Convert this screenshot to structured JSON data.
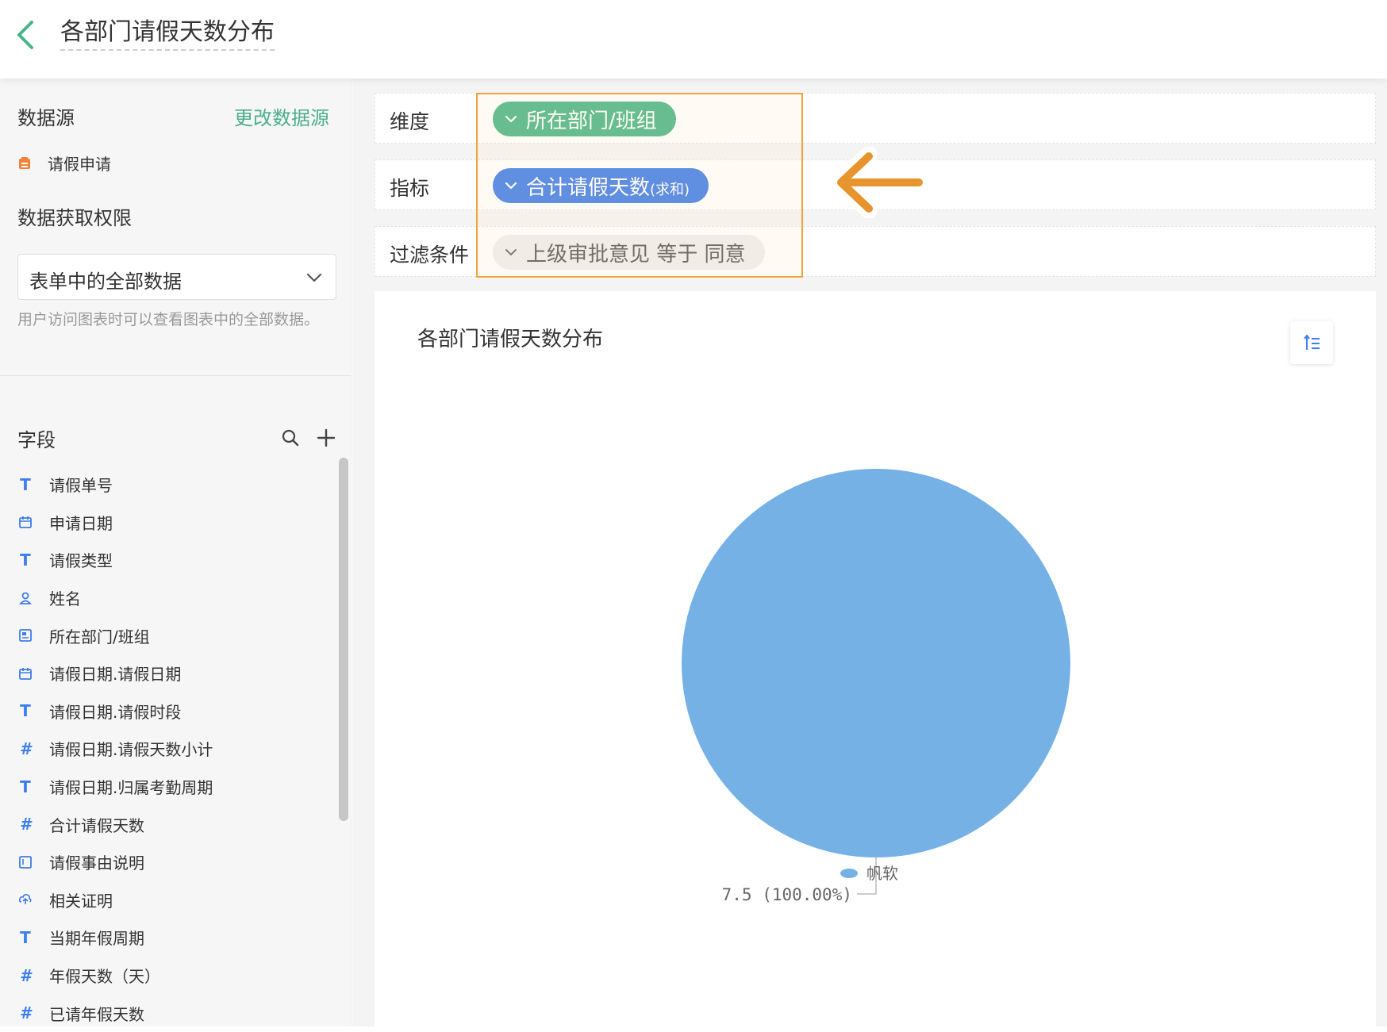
{
  "header": {
    "title": "各部门请假天数分布"
  },
  "sidebar": {
    "data_source_title": "数据源",
    "change_source_label": "更改数据源",
    "source_name": "请假申请",
    "permission_title": "数据获取权限",
    "permission_value": "表单中的全部数据",
    "permission_hint": "用户访问图表时可以查看图表中的全部数据。",
    "fields_title": "字段",
    "fields": [
      {
        "icon": "text-icon",
        "label": "请假单号"
      },
      {
        "icon": "calendar-icon",
        "label": "申请日期"
      },
      {
        "icon": "text-icon",
        "label": "请假类型"
      },
      {
        "icon": "person-icon",
        "label": "姓名"
      },
      {
        "icon": "department-icon",
        "label": "所在部门/班组"
      },
      {
        "icon": "calendar-icon",
        "label": "请假日期.请假日期"
      },
      {
        "icon": "text-icon",
        "label": "请假日期.请假时段"
      },
      {
        "icon": "number-icon",
        "label": "请假日期.请假天数小计"
      },
      {
        "icon": "text-icon",
        "label": "请假日期.归属考勤周期"
      },
      {
        "icon": "number-icon",
        "label": "合计请假天数"
      },
      {
        "icon": "textarea-icon",
        "label": "请假事由说明"
      },
      {
        "icon": "upload-icon",
        "label": "相关证明"
      },
      {
        "icon": "text-icon",
        "label": "当期年假周期"
      },
      {
        "icon": "number-icon",
        "label": "年假天数（天）"
      },
      {
        "icon": "number-icon",
        "label": "已请年假天数"
      }
    ]
  },
  "config": {
    "dimension_label": "维度",
    "dimension_value": "所在部门/班组",
    "metric_label": "指标",
    "metric_value": "合计请假天数",
    "metric_suffix": "(求和)",
    "filter_label": "过滤条件",
    "filter_value": "上级审批意见 等于 同意"
  },
  "colors": {
    "accent_green": "#46b585",
    "accent_blue": "#3e7dea",
    "pie_fill": "#76b1e6",
    "highlight_orange": "#f2a33c"
  },
  "chart_data": {
    "type": "pie",
    "title": "各部门请假天数分布",
    "categories": [
      "帆软"
    ],
    "values": [
      7.5
    ],
    "labels": [
      "7.5 (100.00%)"
    ],
    "legend": [
      "帆软"
    ],
    "legend_position": "bottom"
  }
}
